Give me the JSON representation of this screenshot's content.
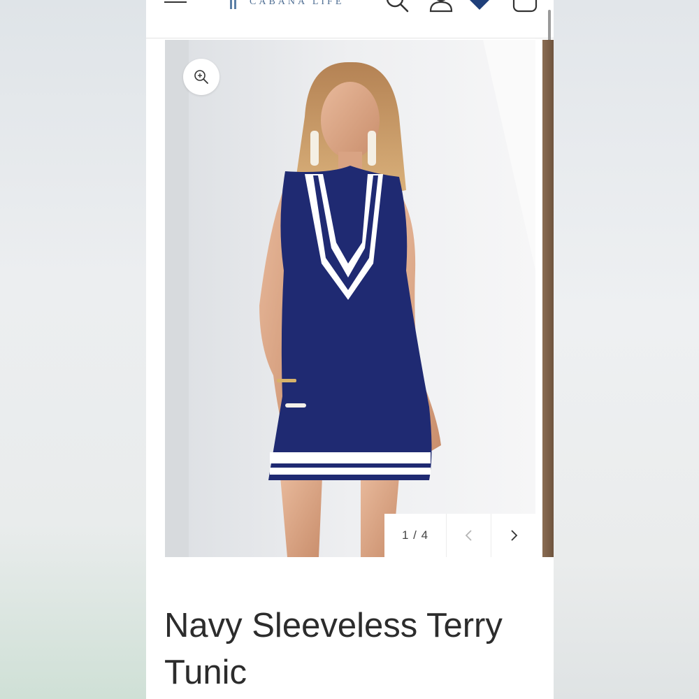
{
  "header": {
    "logo_text": "CABANA LIFE",
    "menu_icon": "hamburger-menu-icon",
    "search_icon": "search-icon",
    "account_icon": "account-icon",
    "wishlist_icon": "heart-icon",
    "cart_icon": "shopping-bag-icon"
  },
  "gallery": {
    "zoom_icon": "zoom-in-icon",
    "current_page": 1,
    "total_pages": 4,
    "counter_text": "1 / 4",
    "prev_icon": "chevron-left-icon",
    "next_icon": "chevron-right-icon"
  },
  "product": {
    "title": "Navy Sleeveless Terry Tunic"
  },
  "colors": {
    "brand": "#4f6e93",
    "dress_navy": "#1f2a72",
    "trim_white": "#ffffff",
    "text": "#2c2c2c"
  }
}
